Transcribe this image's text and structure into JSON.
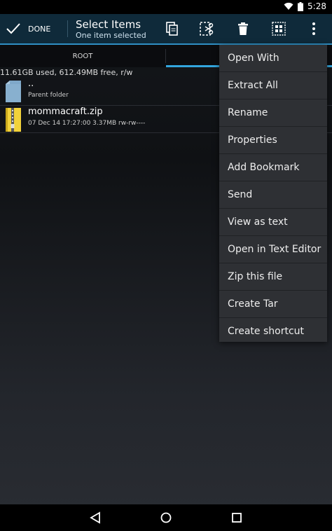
{
  "status_bar": {
    "time": "5:28"
  },
  "action_bar": {
    "done_label": "DONE",
    "title": "Select Items",
    "subtitle": "One item selected"
  },
  "tabs": [
    {
      "label": "ROOT"
    },
    {
      "label": ""
    }
  ],
  "storage_info": "11.61GB used, 612.49MB free, r/w",
  "files": [
    {
      "name": "..",
      "meta": "Parent folder"
    },
    {
      "name": "mommacraft.zip",
      "meta": "07 Dec 14 17:27:00  3.37MB  rw-rw----"
    }
  ],
  "menu": {
    "items": [
      "Open With",
      "Extract All",
      "Rename",
      "Properties",
      "Add Bookmark",
      "Send",
      "View as text",
      "Open in Text Editor",
      "Zip this file",
      "Create Tar",
      "Create shortcut"
    ]
  },
  "colors": {
    "action_bar": "#0f2a3a",
    "accent": "#2f8fc4",
    "tab_indicator": "#33a6de",
    "menu_bg": "#2e3034"
  },
  "icons": {
    "toolbar": [
      "copy-icon",
      "cut-icon",
      "delete-icon",
      "select-all-icon",
      "overflow-menu-icon"
    ],
    "nav": [
      "back-icon",
      "home-icon",
      "recents-icon"
    ]
  }
}
